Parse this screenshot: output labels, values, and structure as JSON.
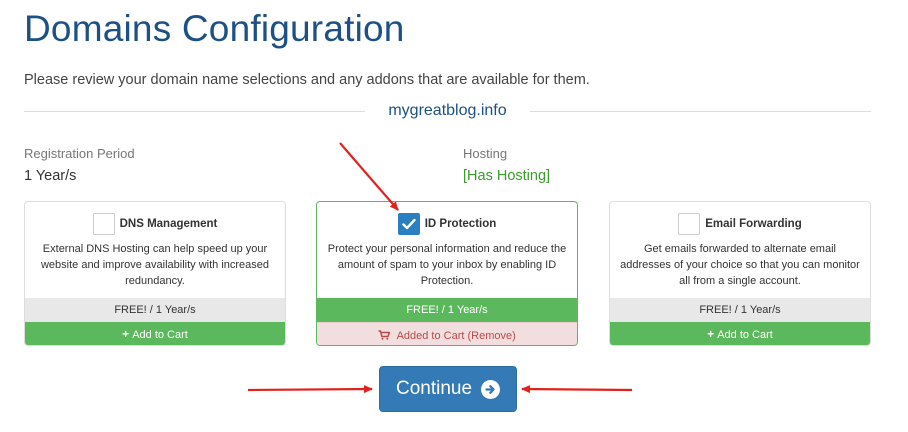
{
  "page": {
    "title": "Domains Configuration",
    "intro": "Please review your domain name selections and any addons that are available for them."
  },
  "domain": {
    "name": "mygreatblog.info",
    "registration_label": "Registration Period",
    "registration_value": "1 Year/s",
    "hosting_label": "Hosting",
    "hosting_value": "[Has Hosting]"
  },
  "addons": [
    {
      "name": "DNS Management",
      "selected": false,
      "description": "External DNS Hosting can help speed up your website and improve availability with increased redundancy.",
      "price": "FREE! / 1 Year/s",
      "cart_label": "Add to Cart"
    },
    {
      "name": "ID Protection",
      "selected": true,
      "description": "Protect your personal information and reduce the amount of spam to your inbox by enabling ID Protection.",
      "price": "FREE! / 1 Year/s",
      "cart_label": "Added to Cart (Remove)"
    },
    {
      "name": "Email Forwarding",
      "selected": false,
      "description": "Get emails forwarded to alternate email addresses of your choice so that you can monitor all from a single account.",
      "price": "FREE! / 1 Year/s",
      "cart_label": "Add to Cart"
    }
  ],
  "actions": {
    "continue_label": "Continue"
  },
  "icons": {
    "add_to_cart": "plus-icon",
    "added_to_cart": "shopping-cart-icon",
    "checkbox_checked": "checkmark-icon",
    "continue": "circle-arrow-right-icon"
  },
  "colors": {
    "title": "#1d5184",
    "primary_button": "#337ab7",
    "success": "#5cb85c",
    "hosting_text": "#3c9a2e",
    "added_bg": "#f2dede",
    "added_text": "#b94a48",
    "checkbox_checked": "#2a7fc1",
    "annotation_arrow": "#e3211c"
  }
}
